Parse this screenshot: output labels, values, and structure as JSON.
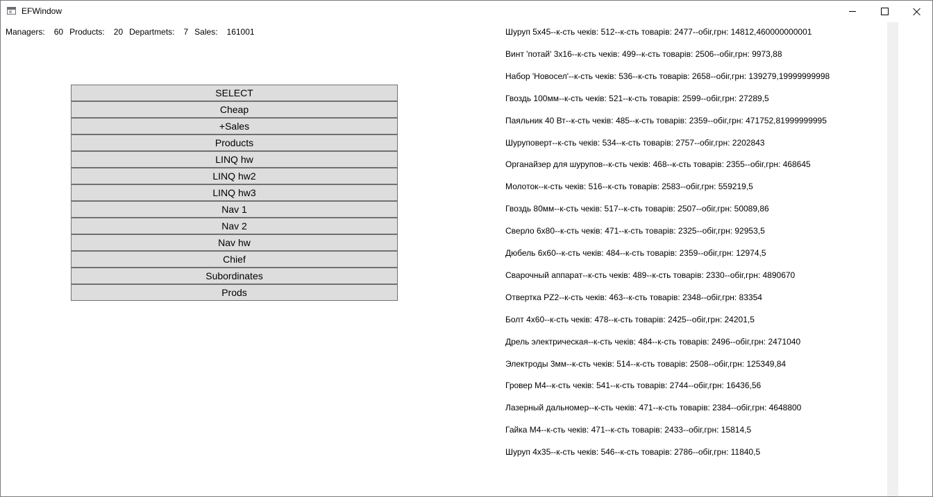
{
  "window": {
    "title": "EFWindow"
  },
  "stats": {
    "managers_label": "Managers:",
    "managers_value": "60",
    "products_label": "Products:",
    "products_value": "20",
    "departments_label": "Departmets:",
    "departments_value": "7",
    "sales_label": "Sales:",
    "sales_value": "161001"
  },
  "buttons": [
    "SELECT",
    "Cheap",
    "+Sales",
    "Products",
    "LINQ hw",
    "LINQ hw2",
    "LINQ hw3",
    "Nav 1",
    "Nav 2",
    "Nav hw",
    "Chief",
    "Subordinates",
    "Prods"
  ],
  "results": [
    "Шуруп 5х45--к-сть чеків: 512--к-сть товарів: 2477--обіг,грн: 14812,460000000001",
    "Винт 'потай' 3х16--к-сть чеків: 499--к-сть товарів: 2506--обіг,грн: 9973,88",
    "Набор 'Новосел'--к-сть чеків: 536--к-сть товарів: 2658--обіг,грн: 139279,19999999998",
    "Гвоздь 100мм--к-сть чеків: 521--к-сть товарів: 2599--обіг,грн: 27289,5",
    "Паяльник 40 Вт--к-сть чеків: 485--к-сть товарів: 2359--обіг,грн: 471752,81999999995",
    "Шуруповерт--к-сть чеків: 534--к-сть товарів: 2757--обіг,грн: 2202843",
    "Органайзер для шурупов--к-сть чеків: 468--к-сть товарів: 2355--обіг,грн: 468645",
    "Молоток--к-сть чеків: 516--к-сть товарів: 2583--обіг,грн: 559219,5",
    "Гвоздь 80мм--к-сть чеків: 517--к-сть товарів: 2507--обіг,грн: 50089,86",
    "Сверло 6х80--к-сть чеків: 471--к-сть товарів: 2325--обіг,грн: 92953,5",
    "Дюбель 6х60--к-сть чеків: 484--к-сть товарів: 2359--обіг,грн: 12974,5",
    "Сварочный аппарат--к-сть чеків: 489--к-сть товарів: 2330--обіг,грн: 4890670",
    "Отвертка PZ2--к-сть чеків: 463--к-сть товарів: 2348--обіг,грн: 83354",
    "Болт 4х60--к-сть чеків: 478--к-сть товарів: 2425--обіг,грн: 24201,5",
    "Дрель электрическая--к-сть чеків: 484--к-сть товарів: 2496--обіг,грн: 2471040",
    "Электроды 3мм--к-сть чеків: 514--к-сть товарів: 2508--обіг,грн: 125349,84",
    "Гровер М4--к-сть чеків: 541--к-сть товарів: 2744--обіг,грн: 16436,56",
    "Лазерный дальномер--к-сть чеків: 471--к-сть товарів: 2384--обіг,грн: 4648800",
    "Гайка М4--к-сть чеків: 471--к-сть товарів: 2433--обіг,грн: 15814,5",
    "Шуруп 4х35--к-сть чеків: 546--к-сть товарів: 2786--обіг,грн: 11840,5"
  ]
}
